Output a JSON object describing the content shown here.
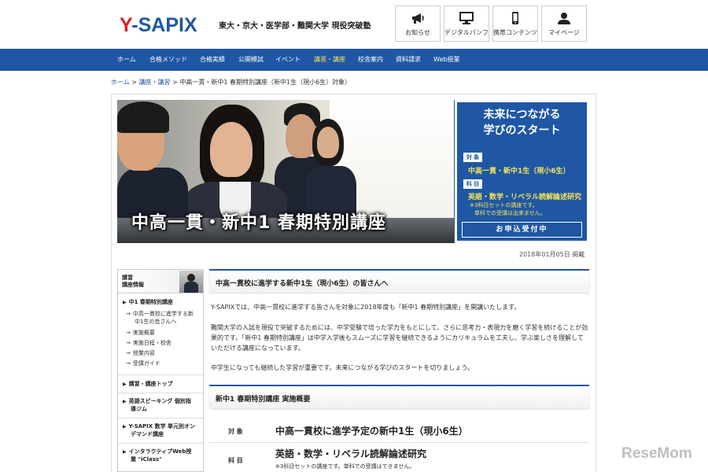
{
  "header": {
    "logo_y": "Y",
    "logo_dash": "-",
    "logo_sapix": "SAPIX",
    "tagline": "東大・京大・医学部・難関大学 現役突破塾",
    "buttons": [
      {
        "label": "お知らせ",
        "icon": "megaphone-icon"
      },
      {
        "label": "デジタルパンフ",
        "icon": "monitor-icon"
      },
      {
        "label": "携帯コンテンツ",
        "icon": "smartphone-icon"
      },
      {
        "label": "マイページ",
        "icon": "user-icon"
      }
    ]
  },
  "nav": {
    "items": [
      "ホーム",
      "合格メソッド",
      "合格実績",
      "公開模試",
      "イベント",
      "講習・講座",
      "校舎案内",
      "資料請求",
      "Web授業"
    ],
    "active_index": 5
  },
  "breadcrumb": {
    "home": "ホーム",
    "sep1": " > ",
    "section": "講座・講習",
    "sep2": " > ",
    "current": "中高一貫・新中1 春期特別講座（新中1生（現小6生）対象）"
  },
  "hero": {
    "title": "中高一貫・新中1 春期特別講座",
    "panel_heading_1": "未来につながる",
    "panel_heading_2": "学びのスタート",
    "target_tag": "対 象",
    "target_value": "中高一貫・新中1生（現小6生）",
    "subject_tag": "科 目",
    "subject_value": "英語・数学・リベラル読解論述研究",
    "note_1": "※3科目セットの講座です。",
    "note_2": "単科での受講は出来ません。",
    "cta": "お申込受付中"
  },
  "posted_date": "2018年01月05日 掲載",
  "sidebar": {
    "title_1": "講習",
    "title_2": "講座情報",
    "current_section": "中1 春期特別講座",
    "sub_items": [
      "中高一貫校に進学する新",
      "中1生の皆さんへ",
      "実施概要",
      "実施日程・校舎",
      "授業内容",
      "受講ガイド"
    ],
    "sections": [
      [
        "講習・講座トップ"
      ],
      [
        "英語スピーキング 個別指",
        "導ジム"
      ],
      [
        "Y-SAPIX 数学 単元別オン",
        "デマンド講座"
      ],
      [
        "インタラクティブWeb授",
        "業 \"iClass\""
      ]
    ]
  },
  "content": {
    "intro_heading": "中高一貫校に進学する新中1生（現小6生）の皆さんへ",
    "para_1": "Y-SAPIXでは、中高一貫校に進学する皆さんを対象に2018年度も「新中1 春期特別講座」を開講いたします。",
    "para_2": "難関大学の入試を現役で突破するためには、中学受験で培った学力をもとにして、さらに思考力・表現力を磨く学習を続けることが効果的です。「新中1 春期特別講座」は中学入学後もスムーズに学習を継続できるようにカリキュラムを工夫し、学ぶ楽しさを理解していただける講座になっています。",
    "para_3": "中学生になっても継続した学習が重要です。未来につながる学びのスタートを切りましょう。",
    "overview_heading": "新中1 春期特別講座 実施概要",
    "row_target_label": "対 象",
    "row_target_value": "中高一貫校に進学予定の新中1生（現小6生）",
    "row_subject_label": "科 目",
    "row_subject_value": "英語・数学・リベラル読解論述研究",
    "row_subject_note": "※3科目セットの講座です。単科での受講はできません。"
  },
  "watermark": "ReseMom",
  "colors": {
    "brand_blue": "#1f57a4",
    "brand_red": "#d8232a",
    "accent_yellow": "#f5e25b"
  }
}
